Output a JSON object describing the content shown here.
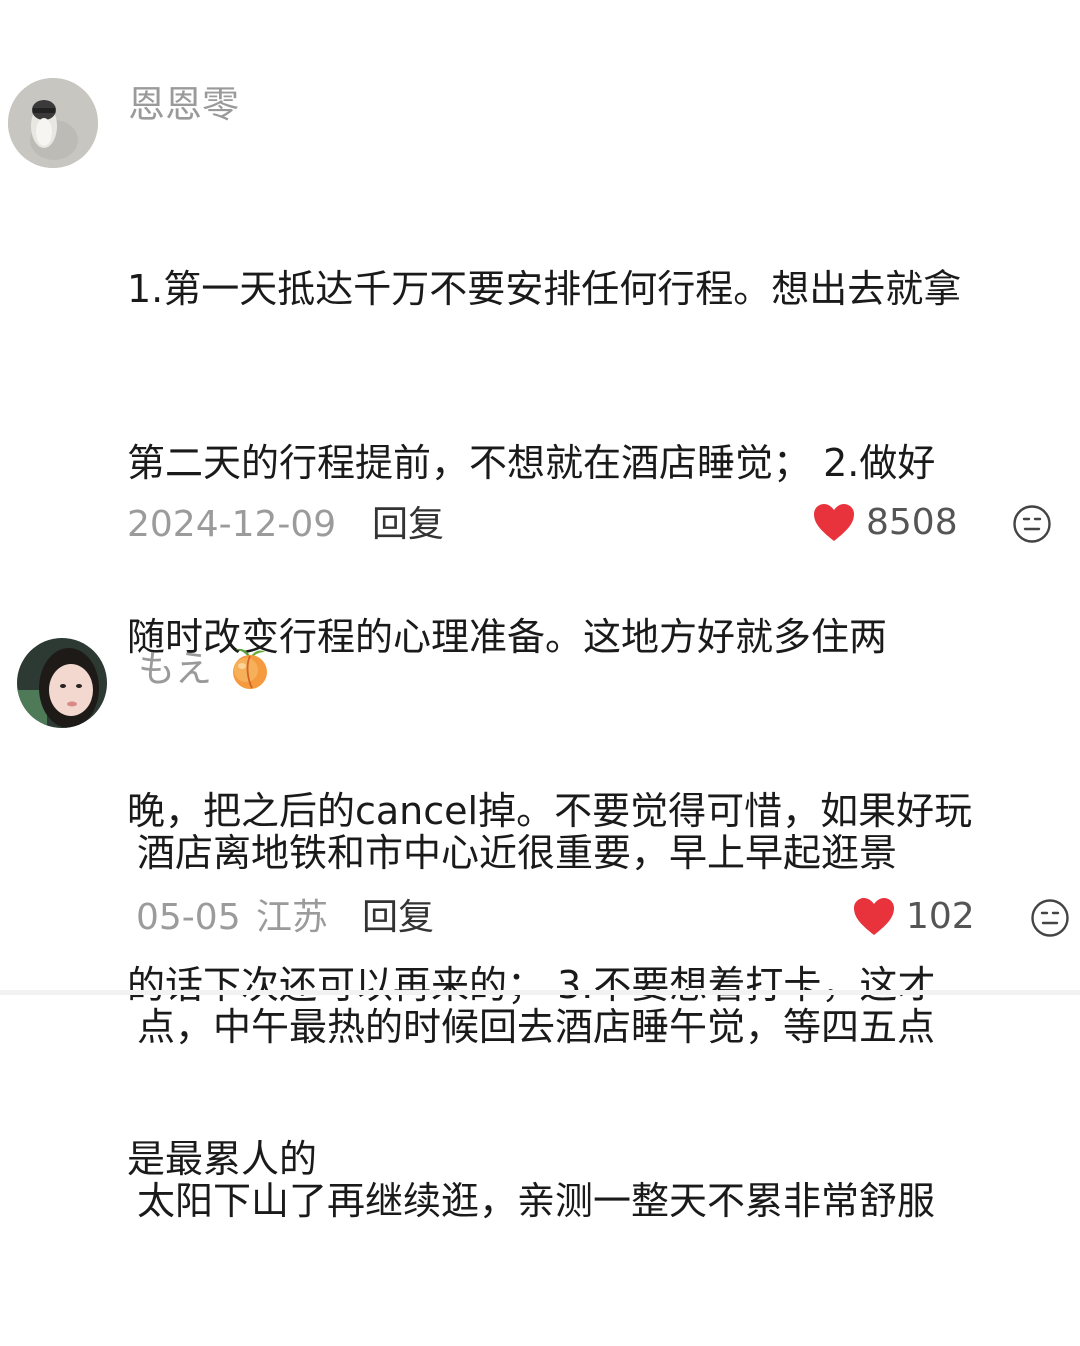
{
  "comments": [
    {
      "username": "恩恩零",
      "text_lines": [
        "1.第一天抵达千万不要安排任何行程。想出去就拿",
        "第二天的行程提前，不想就在酒店睡觉； 2.做好",
        "随时改变行程的心理准备。这地方好就多住两",
        "晚，把之后的cancel掉。不要觉得可惜，如果好玩",
        "的话下次还可以再来的； 3.不要想着打卡，这才",
        "是最累人的"
      ],
      "date": "2024-12-09",
      "reply_label": "回复",
      "like_count": "8508",
      "like_icon": "heart-icon",
      "dislike_icon": "neutral-face-icon"
    },
    {
      "username": "もえ",
      "username_emoji": "🍑",
      "text_lines": [
        "酒店离地铁和市中心近很重要，早上早起逛景",
        "点，中午最热的时候回去酒店睡午觉，等四五点",
        "太阳下山了再继续逛，亲测一整天不累非常舒服"
      ],
      "date": "05-05",
      "location": "江苏",
      "reply_label": "回复",
      "like_count": "102",
      "like_icon": "heart-icon",
      "dislike_icon": "neutral-face-icon"
    }
  ],
  "colors": {
    "heart": "#e8323c",
    "meta_text": "#9b9b9b",
    "body_text": "#1a1a1a"
  }
}
